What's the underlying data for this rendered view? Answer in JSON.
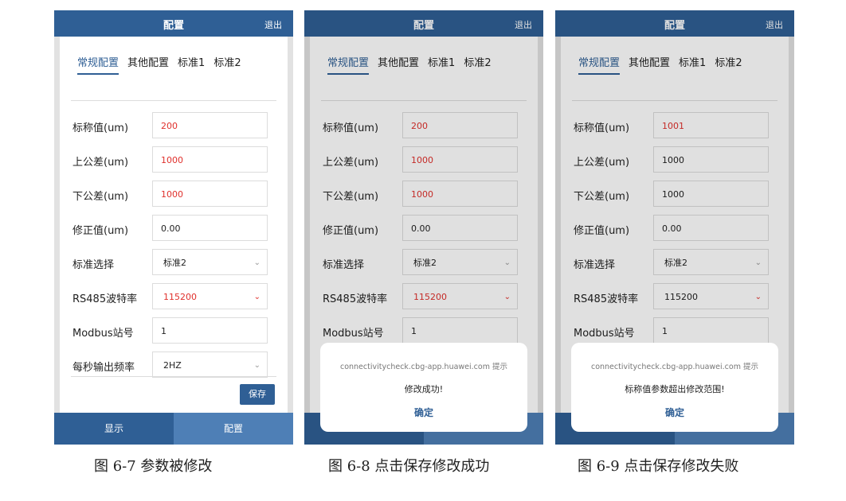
{
  "common": {
    "header_title": "配置",
    "exit_label": "退出",
    "tabs": [
      "常规配置",
      "其他配置",
      "标准1",
      "标准2"
    ],
    "labels": [
      "标称值(um)",
      "上公差(um)",
      "下公差(um)",
      "修正值(um)",
      "标准选择",
      "RS485波特率",
      "Modbus站号",
      "每秒输出频率"
    ],
    "save_label": "保存",
    "bottom_nav": [
      "显示",
      "配置"
    ]
  },
  "screens": [
    {
      "values": [
        "200",
        "1000",
        "1000",
        "0.00",
        "标准2",
        "115200",
        "1",
        "2HZ"
      ],
      "caption": "图 6-7 参数被修改"
    },
    {
      "values": [
        "200",
        "1000",
        "1000",
        "0.00",
        "标准2",
        "115200",
        "1"
      ],
      "dialog": {
        "host": "connectivitycheck.cbg-app.huawei.com 提示",
        "message": "修改成功!",
        "ok": "确定"
      },
      "caption": "图 6-8  点击保存修改成功"
    },
    {
      "values": [
        "1001",
        "1000",
        "1000",
        "0.00",
        "标准2",
        "115200",
        "1"
      ],
      "dialog": {
        "host": "connectivitycheck.cbg-app.huawei.com 提示",
        "message": "标称值参数超出修改范围!",
        "ok": "确定"
      },
      "caption": "图 6-9 点击保存修改失败"
    }
  ],
  "colors": {
    "primary": "#2f5f95",
    "primary_light": "#4e7fb6",
    "modified_red": "#e0302c"
  }
}
